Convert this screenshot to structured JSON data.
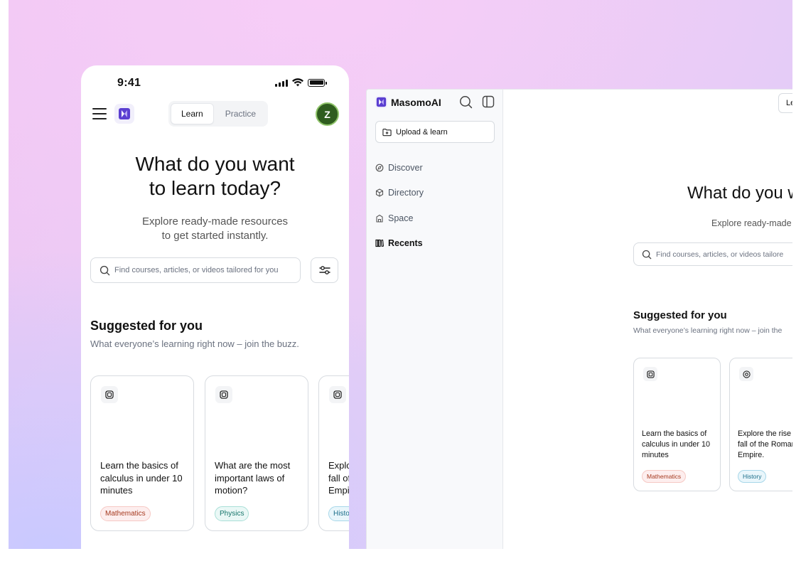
{
  "colors": {
    "brand": "#5b3fd1",
    "avatar_bg": "#2f5d1f",
    "avatar_ring": "#8fc46a"
  },
  "phone": {
    "status_time": "9:41",
    "tabs": [
      {
        "label": "Learn",
        "active": true
      },
      {
        "label": "Practice",
        "active": false
      }
    ],
    "avatar_initial": "Z",
    "hero_line1": "What do you want",
    "hero_line2": "to learn today?",
    "sub_line1": "Explore ready-made resources",
    "sub_line2": "to get started instantly.",
    "search_placeholder": "Find courses, articles, or videos tailored for you",
    "section_title": "Suggested for you",
    "section_subtitle": "What everyone’s learning right now – join the buzz.",
    "cards": [
      {
        "icon": "book-icon",
        "title": "Learn the basics of calculus in under 10 minutes",
        "tag": "Mathematics"
      },
      {
        "icon": "book-icon",
        "title": "What are the most important laws of motion?",
        "tag": "Physics"
      },
      {
        "icon": "book-icon",
        "title": "Explore the rise and fall of the Roman Empire.",
        "tag": "History"
      }
    ]
  },
  "desktop": {
    "app_name": "MasomoAI",
    "upload_label": "Upload & learn",
    "nav": [
      {
        "label": "Discover",
        "icon": "compass-icon",
        "active": false
      },
      {
        "label": "Directory",
        "icon": "cube-icon",
        "active": false
      },
      {
        "label": "Space",
        "icon": "building-icon",
        "active": false
      },
      {
        "label": "Recents",
        "icon": "books-icon",
        "active": true
      }
    ],
    "top_button_label": "Le",
    "hero": "What do you w",
    "sub": "Explore ready-made",
    "search_placeholder": "Find courses, articles, or videos tailore",
    "section_title": "Suggested for you",
    "section_subtitle": "What everyone’s learning right now – join the",
    "cards": [
      {
        "icon": "book-icon",
        "title": "Learn the basics of calculus in under 10 minutes",
        "tag": "Mathematics"
      },
      {
        "icon": "target-icon",
        "title": "Explore the rise and fall of the Roman Empire.",
        "tag": "History"
      }
    ]
  }
}
